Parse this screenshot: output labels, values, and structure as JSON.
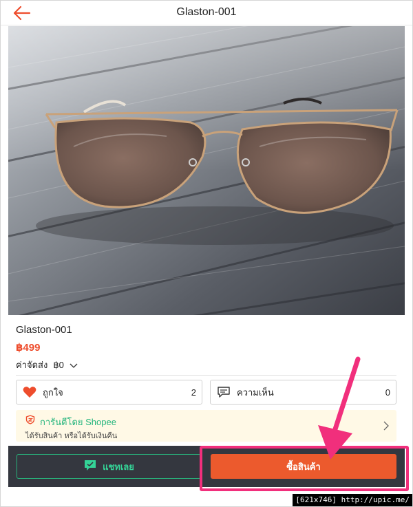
{
  "header": {
    "title": "Glaston-001",
    "back_icon": "back-arrow-icon"
  },
  "colors": {
    "accent": "#ee4d2d",
    "guarantee_green": "#22b47c",
    "bottom_bar": "#34373f",
    "highlight": "#f12f7c"
  },
  "product": {
    "name": "Glaston-001",
    "price": "฿499",
    "shipping_label": "ค่าจัดส่ง",
    "shipping_value": "฿0"
  },
  "stats": {
    "likes": {
      "label": "ถูกใจ",
      "count": "2",
      "icon": "heart-icon"
    },
    "comments": {
      "label": "ความเห็น",
      "count": "0",
      "icon": "chat-bubble-icon"
    }
  },
  "guarantee": {
    "title": "การันตีโดย Shopee",
    "subtitle": "ได้รับสินค้า หรือได้รับเงินคืน",
    "icon": "shield-icon"
  },
  "actions": {
    "chat_label": "แชทเลย",
    "buy_label": "ซื้อสินค้า"
  },
  "watermark": "[621x746] http://upic.me/"
}
